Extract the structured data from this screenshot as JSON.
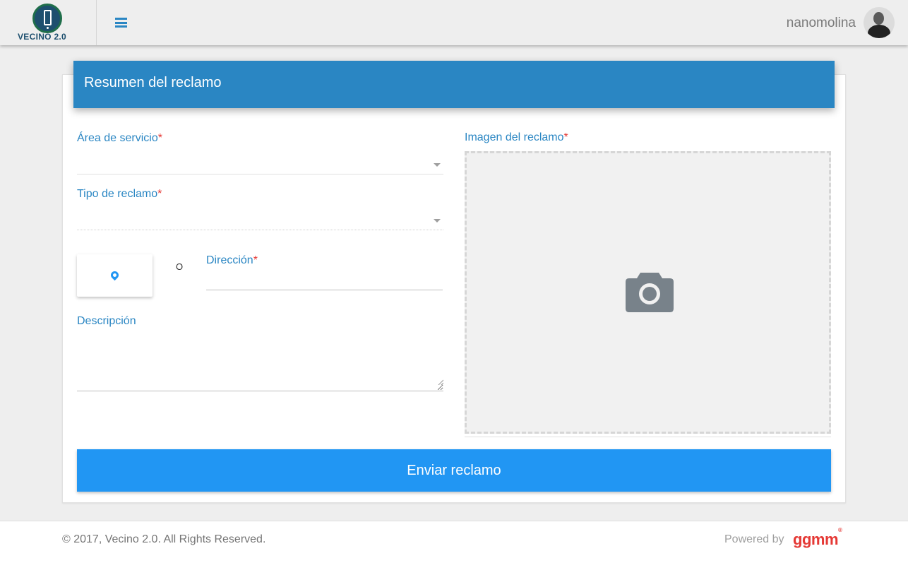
{
  "header": {
    "logo_text": "VECINO 2.0",
    "menu_icon": "menu-icon",
    "username": "nanomolina",
    "avatar_icon": "user-avatar"
  },
  "card": {
    "title": "Resumen del reclamo",
    "required_mark": "*",
    "fields": {
      "area_label": "Área de servicio",
      "tipo_label": "Tipo de reclamo",
      "or_text": "O",
      "direccion_label": "Dirección",
      "direccion_value": "",
      "descripcion_label": "Descripción",
      "descripcion_value": "",
      "imagen_label": "Imagen del reclamo"
    },
    "gps_icon": "map-marker-icon",
    "camera_icon": "camera-icon",
    "submit_label": "Enviar reclamo"
  },
  "footer": {
    "copyright": "© 2017, Vecino 2.0. All Rights Reserved.",
    "powered_by": "Powered by",
    "brand": "ggmm",
    "brand_mark": "®"
  },
  "colors": {
    "primary": "#2a86c3",
    "button": "#2196f3",
    "required": "#e53935",
    "brand": "#e53935"
  }
}
